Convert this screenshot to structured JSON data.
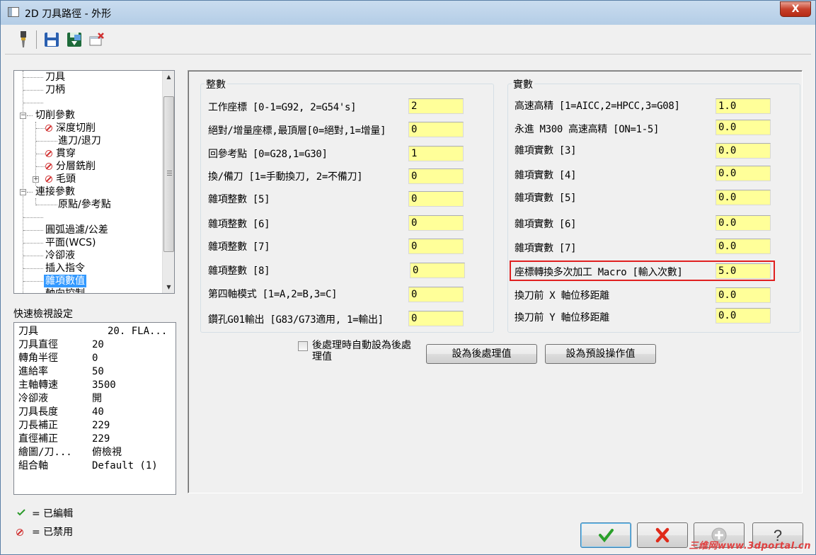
{
  "window": {
    "title": "2D 刀具路徑 - 外形",
    "close_label": "X"
  },
  "toolbar": {
    "icons": [
      "tool-icon",
      "save-icon",
      "export-icon",
      "delete-icon"
    ]
  },
  "tree": {
    "items": [
      {
        "label": "刀具"
      },
      {
        "label": "刀柄"
      },
      {
        "label": ""
      },
      {
        "label": "切削參數"
      },
      {
        "label": "深度切削"
      },
      {
        "label": "進刀/退刀"
      },
      {
        "label": "貫穿"
      },
      {
        "label": "分層銑削"
      },
      {
        "label": "毛頭"
      },
      {
        "label": "連接參數"
      },
      {
        "label": "原點/參考點"
      },
      {
        "label": ""
      },
      {
        "label": "圓弧過濾/公差"
      },
      {
        "label": "平面(WCS)"
      },
      {
        "label": "冷卻液"
      },
      {
        "label": "插入指令"
      },
      {
        "label": "雜項數值"
      },
      {
        "label": "軸向控制"
      }
    ]
  },
  "quick_view": {
    "title": "快速檢視設定",
    "rows": [
      {
        "key": "刀具",
        "value": "20. FLA..."
      },
      {
        "key": "刀具直徑",
        "value": "20"
      },
      {
        "key": "轉角半徑",
        "value": "0"
      },
      {
        "key": "進給率",
        "value": "50"
      },
      {
        "key": "主軸轉速",
        "value": "3500"
      },
      {
        "key": "冷卻液",
        "value": "開"
      },
      {
        "key": "刀具長度",
        "value": "40"
      },
      {
        "key": "刀長補正",
        "value": "229"
      },
      {
        "key": "直徑補正",
        "value": "229"
      },
      {
        "key": "繪圖/刀...",
        "value": "俯檢視"
      },
      {
        "key": "組合軸",
        "value": "Default (1)"
      }
    ]
  },
  "legend": {
    "edited": "= 已編輯",
    "disabled": "= 已禁用"
  },
  "integers": {
    "title": "整數",
    "fields": [
      {
        "label": "工作座標 [0-1=G92, 2=G54's]",
        "value": "2"
      },
      {
        "label": "絕對/增量座標,最頂層[0=絕對,1=增量]",
        "value": "0"
      },
      {
        "label": "回參考點 [0=G28,1=G30]",
        "value": "1"
      },
      {
        "label": "換/備刀 [1=手動換刀, 2=不備刀]",
        "value": "0"
      },
      {
        "label": "雜項整數 [5]",
        "value": "0"
      },
      {
        "label": "雜項整數 [6]",
        "value": "0"
      },
      {
        "label": "雜項整數 [7]",
        "value": "0"
      },
      {
        "label": "雜項整數 [8]",
        "value": "0"
      },
      {
        "label": "第四軸模式 [1=A,2=B,3=C]",
        "value": "0"
      },
      {
        "label": "鑽孔G01輸出 [G83/G73適用, 1=輸出]",
        "value": "0"
      }
    ]
  },
  "reals": {
    "title": "實數",
    "fields": [
      {
        "label": "高速高精 [1=AICC,2=HPCC,3=G08]",
        "value": "1.0"
      },
      {
        "label": "永進 M300 高速高精 [ON=1-5]",
        "value": "0.0"
      },
      {
        "label": "雜項實數 [3]",
        "value": "0.0"
      },
      {
        "label": "雜項實數 [4]",
        "value": "0.0"
      },
      {
        "label": "雜項實數 [5]",
        "value": "0.0"
      },
      {
        "label": "雜項實數 [6]",
        "value": "0.0"
      },
      {
        "label": "雜項實數 [7]",
        "value": "0.0"
      },
      {
        "label": "座標轉換多次加工 Macro [輸入次數]",
        "value": "5.0"
      },
      {
        "label": "換刀前 X 軸位移距離",
        "value": "0.0"
      },
      {
        "label": "換刀前 Y 軸位移距離",
        "value": "0.0"
      }
    ]
  },
  "post_auto": {
    "label": "後處理時自動設為後處理值",
    "checked": false
  },
  "buttons": {
    "set_post": "設為後處理值",
    "set_default": "設為預設操作值"
  },
  "dialog_buttons": [
    "ok-icon",
    "cancel-icon",
    "add-icon",
    "help-icon"
  ],
  "watermark": "三维网www.3dportal.cn"
}
